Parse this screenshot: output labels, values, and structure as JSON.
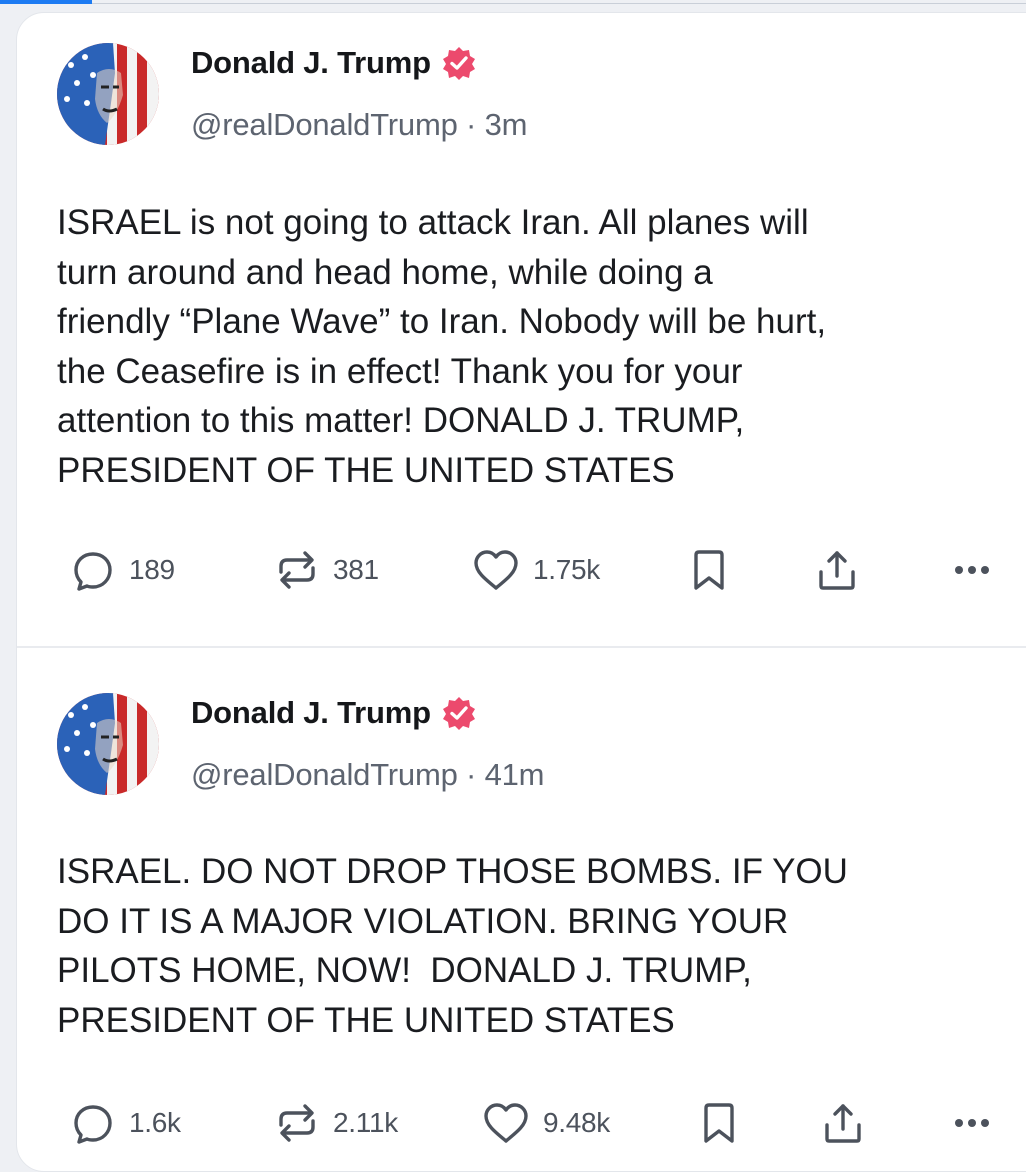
{
  "posts": [
    {
      "author": "Donald J. Trump",
      "handle": "@realDonaldTrump",
      "time": "3m",
      "text": "ISRAEL is not going to attack Iran. All planes will\nturn around and head home, while doing a\nfriendly “Plane Wave” to Iran. Nobody will be hurt,\nthe Ceasefire is in effect! Thank you for your\nattention to this matter! DONALD J. TRUMP,\nPRESIDENT OF THE UNITED STATES",
      "replies": "189",
      "reposts": "381",
      "likes": "1.75k"
    },
    {
      "author": "Donald J. Trump",
      "handle": "@realDonaldTrump",
      "time": "41m",
      "text": "ISRAEL. DO NOT DROP THOSE BOMBS. IF YOU\nDO IT IS A MAJOR VIOLATION. BRING YOUR\nPILOTS HOME, NOW!  DONALD J. TRUMP,\nPRESIDENT OF THE UNITED STATES",
      "replies": "1.6k",
      "reposts": "2.11k",
      "likes": "9.48k"
    }
  ],
  "separator": "·",
  "icons": {
    "verified": "verified-badge-icon",
    "reply": "reply-bubble-icon",
    "repost": "repost-arrows-icon",
    "like": "heart-icon",
    "bookmark": "bookmark-icon",
    "share": "share-upload-icon",
    "more": "more-dots-icon"
  },
  "colors": {
    "verified_badge": "#ec4a6d",
    "text": "#1a1c20",
    "muted": "#5d6470"
  }
}
